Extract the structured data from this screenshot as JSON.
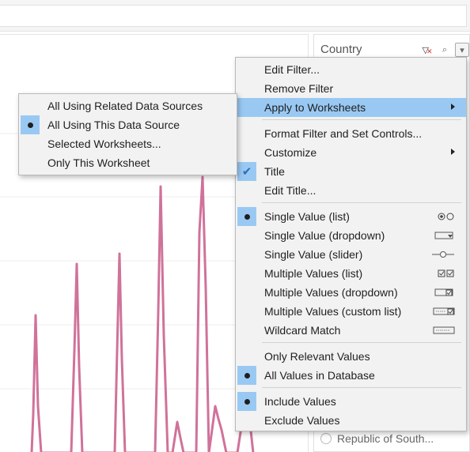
{
  "filter": {
    "title": "Country",
    "visible_item": "Republic of South..."
  },
  "context_menu": {
    "items": [
      {
        "label": "Edit Filter..."
      },
      {
        "label": "Remove Filter"
      },
      {
        "label": "Apply to Worksheets",
        "has_submenu": true,
        "highlighted": true
      },
      {
        "label": "Format Filter and Set Controls..."
      },
      {
        "label": "Customize",
        "has_submenu": true
      },
      {
        "label": "Title",
        "checked": true
      },
      {
        "label": "Edit Title..."
      },
      {
        "label": "Single Value (list)",
        "selected": true,
        "icon": "radio-list-icon"
      },
      {
        "label": "Single Value (dropdown)",
        "icon": "dropdown-icon"
      },
      {
        "label": "Single Value (slider)",
        "icon": "slider-icon"
      },
      {
        "label": "Multiple Values (list)",
        "icon": "checkbox-list-icon"
      },
      {
        "label": "Multiple Values (dropdown)",
        "icon": "checkbox-dropdown-icon"
      },
      {
        "label": "Multiple Values (custom list)",
        "icon": "custom-list-icon"
      },
      {
        "label": "Wildcard Match",
        "icon": "wildcard-icon"
      },
      {
        "label": "Only Relevant Values"
      },
      {
        "label": "All Values in Database",
        "selected": true
      },
      {
        "label": "Include Values",
        "selected": true
      },
      {
        "label": "Exclude Values"
      }
    ]
  },
  "submenu": {
    "items": [
      {
        "label": "All Using Related Data Sources"
      },
      {
        "label": "All Using This Data Source",
        "selected": true
      },
      {
        "label": "Selected Worksheets..."
      },
      {
        "label": "Only This Worksheet"
      }
    ]
  },
  "colors": {
    "highlight": "#99c9f3",
    "line": "#d0729a",
    "menu_bg": "#f2f2f2"
  }
}
